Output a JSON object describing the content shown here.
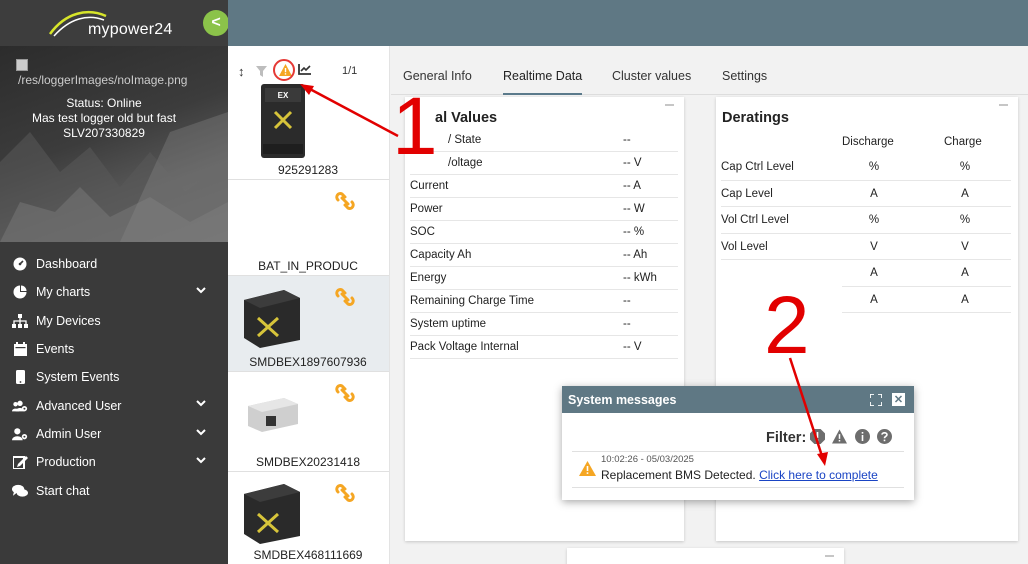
{
  "app": {
    "logo_text": "mypower24",
    "collapse_glyph": "<"
  },
  "profile": {
    "image_alt": "/res/loggerImages/noImage.png",
    "status": "Status: Online",
    "logger_name": "Mas test logger old but fast",
    "serial": "SLV207330829"
  },
  "nav": {
    "items": [
      {
        "label": "Dashboard",
        "icon": "dashboard-gauge-icon",
        "expandable": false
      },
      {
        "label": "My charts",
        "icon": "pie-chart-icon",
        "expandable": true
      },
      {
        "label": "My Devices",
        "icon": "sitemap-icon",
        "expandable": false
      },
      {
        "label": "Events",
        "icon": "calendar-icon",
        "expandable": false
      },
      {
        "label": "System Events",
        "icon": "mobile-icon",
        "expandable": false
      },
      {
        "label": "Advanced User",
        "icon": "users-cog-icon",
        "expandable": true
      },
      {
        "label": "Admin User",
        "icon": "user-cog-icon",
        "expandable": true
      },
      {
        "label": "Production",
        "icon": "edit-icon",
        "expandable": true
      },
      {
        "label": "Start chat",
        "icon": "comments-icon",
        "expandable": false
      }
    ]
  },
  "device_list": {
    "page_indicator": "1/1",
    "devices": [
      {
        "label": "925291283",
        "image": "ex-inverter",
        "unlinked": false,
        "selected": false
      },
      {
        "label": "BAT_IN_PRODUC",
        "image": "none",
        "unlinked": true,
        "selected": false
      },
      {
        "label": "SMDBEX1897607936",
        "image": "battery-box",
        "unlinked": true,
        "selected": true
      },
      {
        "label": "SMDBEX20231418",
        "image": "battery-module",
        "unlinked": true,
        "selected": false
      },
      {
        "label": "SMDBEX468111669",
        "image": "battery-box",
        "unlinked": true,
        "selected": false
      }
    ]
  },
  "tabs": [
    {
      "label": "General Info",
      "active": false
    },
    {
      "label": "Realtime Data",
      "active": true
    },
    {
      "label": "Cluster values",
      "active": false
    },
    {
      "label": "Settings",
      "active": false
    }
  ],
  "general_values": {
    "title": "al Values",
    "rows": [
      {
        "label": "/ State",
        "value": "--"
      },
      {
        "label": "/oltage",
        "value": "-- V"
      },
      {
        "label": "Current",
        "value": "-- A"
      },
      {
        "label": "Power",
        "value": "-- W"
      },
      {
        "label": "SOC",
        "value": "-- %"
      },
      {
        "label": "Capacity Ah",
        "value": "-- Ah"
      },
      {
        "label": "Energy",
        "value": "-- kWh"
      },
      {
        "label": "Remaining Charge Time",
        "value": "--"
      },
      {
        "label": "System uptime",
        "value": "--"
      },
      {
        "label": "Pack Voltage Internal",
        "value": "-- V"
      }
    ]
  },
  "deratings": {
    "title": "Deratings",
    "col_discharge": "Discharge",
    "col_charge": "Charge",
    "rows": [
      {
        "label": "Cap Ctrl Level",
        "discharge": "%",
        "charge": "%"
      },
      {
        "label": "Cap Level",
        "discharge": "A",
        "charge": "A"
      },
      {
        "label": "Vol Ctrl Level",
        "discharge": "%",
        "charge": "%"
      },
      {
        "label": "Vol Level",
        "discharge": "V",
        "charge": "V"
      },
      {
        "label": "",
        "discharge": "A",
        "charge": "A"
      },
      {
        "label": "",
        "discharge": "A",
        "charge": "A"
      }
    ]
  },
  "system_messages": {
    "title": "System messages",
    "filter_label": "Filter:",
    "close_glyph": "✕",
    "message": {
      "timestamp": "10:02:26 - 05/03/2025",
      "text": "Replacement BMS Detected.",
      "link_text": "Click here to complete"
    }
  },
  "annotations": {
    "marker_1": "1",
    "marker_2": "2"
  },
  "colors": {
    "sidebar_bg": "#3a3a3a",
    "topbar_bg": "#5f7884",
    "accent_green": "#8bc34a",
    "warning_orange": "#f5a623",
    "unlink_orange": "#f5a623",
    "annotation_red": "#e20000",
    "link_blue": "#1a44c4"
  }
}
